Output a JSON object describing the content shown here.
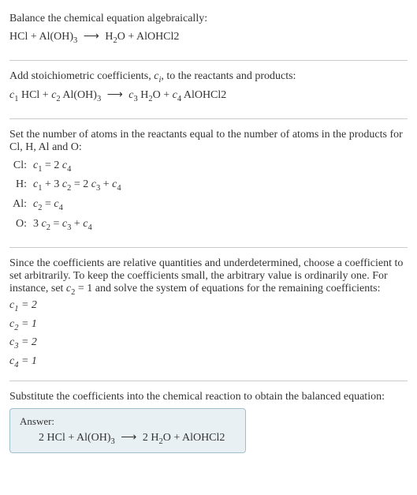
{
  "intro": {
    "title": "Balance the chemical equation algebraically:",
    "eq_lhs_1": "HCl + Al(OH)",
    "eq_lhs_1_sub": "3",
    "eq_arrow": "⟶",
    "eq_rhs_1": "H",
    "eq_rhs_1_sub": "2",
    "eq_rhs_2": "O + AlOHCl2"
  },
  "stoich": {
    "text": "Add stoichiometric coefficients, ",
    "ci": "c",
    "ci_sub": "i",
    "text2": ", to the reactants and products:",
    "c1": "c",
    "c1_sub": "1",
    "sp1": " HCl + ",
    "c2": "c",
    "c2_sub": "2",
    "sp2": " Al(OH)",
    "sp2_sub": "3",
    "arrow": "⟶",
    "c3": "c",
    "c3_sub": "3",
    "sp3": " H",
    "sp3_sub": "2",
    "sp4": "O + ",
    "c4": "c",
    "c4_sub": "4",
    "sp5": " AlOHCl2"
  },
  "atoms": {
    "text": "Set the number of atoms in the reactants equal to the number of atoms in the products for Cl, H, Al and O:",
    "rows": [
      {
        "label": "Cl:",
        "lhs": "c₁",
        "rhs": "2 c₄"
      },
      {
        "label": "H:",
        "lhs": "c₁ + 3 c₂",
        "rhs": "2 c₃ + c₄"
      },
      {
        "label": "Al:",
        "lhs": "c₂",
        "rhs": "c₄"
      },
      {
        "label": "O:",
        "lhs": "3 c₂",
        "rhs": "c₃ + c₄"
      }
    ]
  },
  "solve": {
    "text1": "Since the coefficients are relative quantities and underdetermined, choose a coefficient to set arbitrarily. To keep the coefficients small, the arbitrary value is ordinarily one. For instance, set ",
    "c2": "c",
    "c2_sub": "2",
    "text2": " = 1 and solve the system of equations for the remaining coefficients:",
    "lines": [
      "c₁ = 2",
      "c₂ = 1",
      "c₃ = 2",
      "c₄ = 1"
    ]
  },
  "final": {
    "text": "Substitute the coefficients into the chemical reaction to obtain the balanced equation:",
    "answer_label": "Answer:",
    "eq_1": "2 HCl + Al(OH)",
    "eq_1_sub": "3",
    "arrow": "⟶",
    "eq_2": "2 H",
    "eq_2_sub": "2",
    "eq_3": "O + AlOHCl2"
  }
}
